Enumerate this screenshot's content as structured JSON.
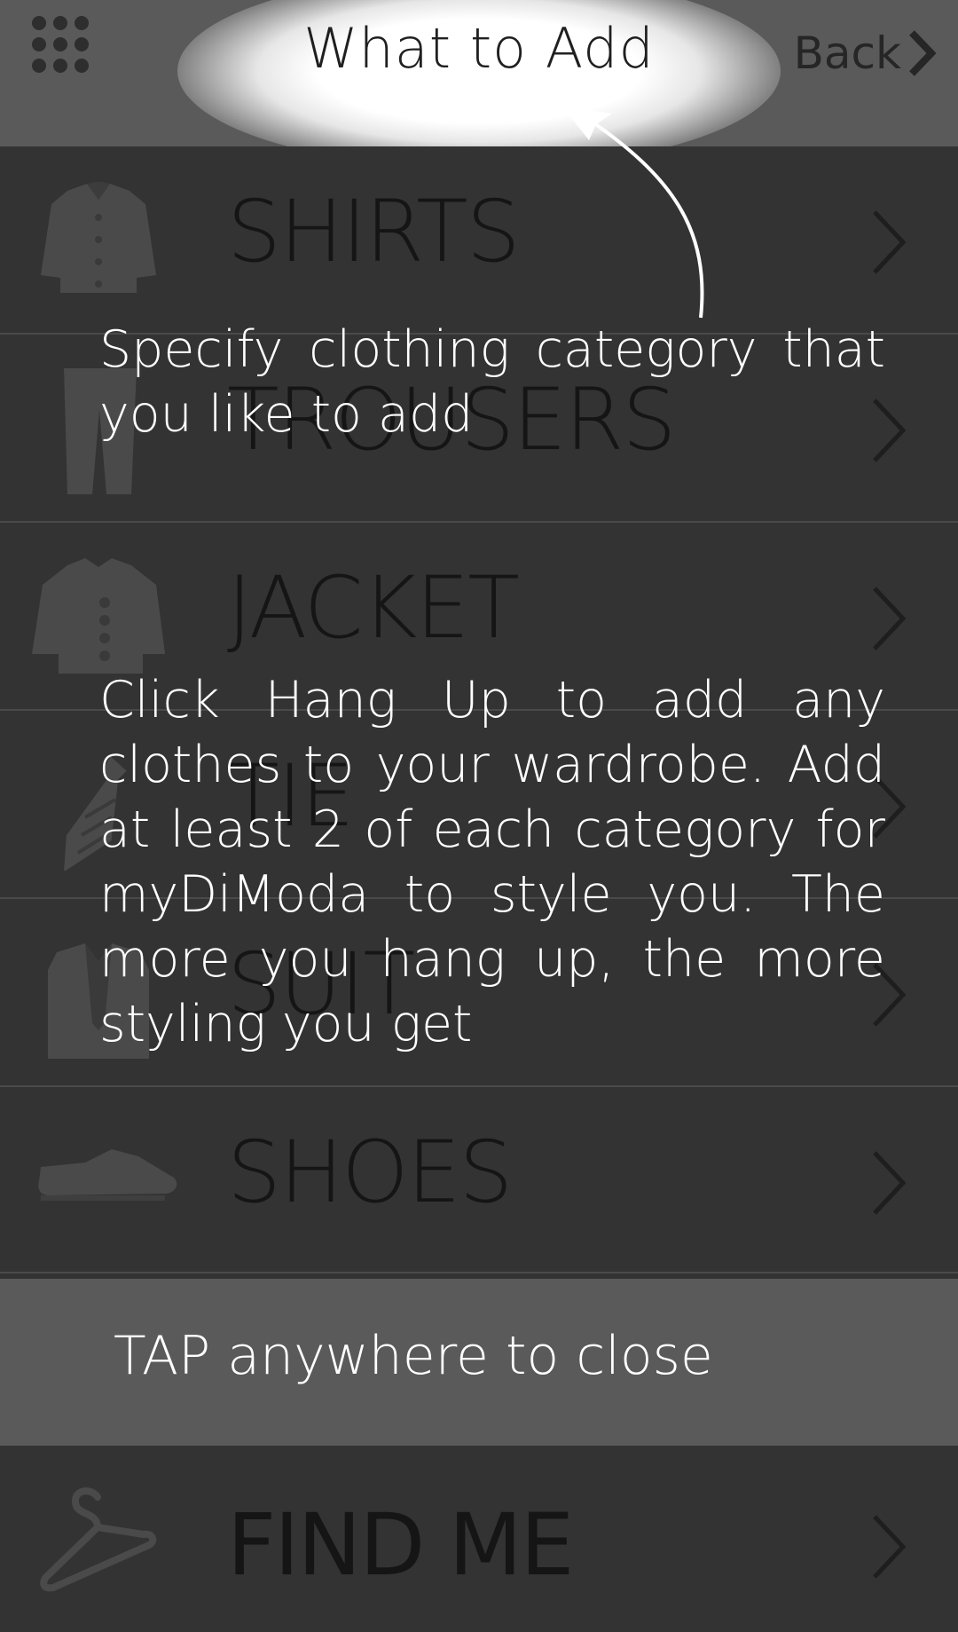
{
  "header": {
    "title": "What to Add",
    "back_label": "Back"
  },
  "categories": [
    {
      "label": "SHIRTS",
      "icon": "shirt-icon"
    },
    {
      "label": "TROUSERS",
      "icon": "trousers-icon"
    },
    {
      "label": "JACKET",
      "icon": "jacket-icon"
    },
    {
      "label": "TIE",
      "icon": "tie-icon"
    },
    {
      "label": "SUIT",
      "icon": "suit-icon"
    },
    {
      "label": "SHOES",
      "icon": "shoe-icon"
    }
  ],
  "find_me": {
    "label": "FIND ME",
    "icon": "hanger-icon"
  },
  "overlay": {
    "tip_category": "Specify clothing category that you like to add",
    "tip_hang_up": "Click Hang Up to add any clothes to your wardrobe. Add at least 2 of each category for myDiModa to style you. The more you hang up, the more styling you get",
    "tap_to_close": "TAP anywhere to close"
  },
  "colors": {
    "background": "#333333",
    "header": "#5a5a5a",
    "overlay_text": "#ffffff",
    "label_text": "#151515"
  }
}
